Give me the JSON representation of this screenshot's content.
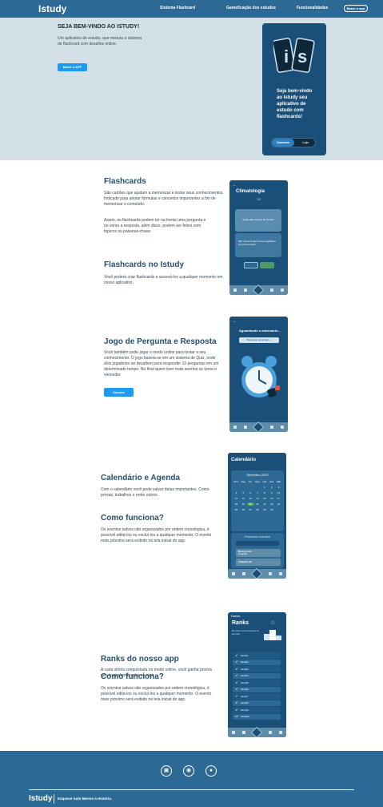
{
  "header": {
    "brand": "Istudy",
    "nav": [
      "Sistema Flashcard",
      "Gameficação dos estudos",
      "Funcionalidades"
    ],
    "cta": "Baixe o app"
  },
  "hero": {
    "title": "SEJA BEM-VINDO AO ISTUDY!",
    "text": "Um aplicativo de estudo, que mistura o sistema de flashcard com desafios online.",
    "button": "Baixe o APP",
    "phone_logo": "iS",
    "phone_text": "Seja bem-vindo ao Istudy seu aplicativo de estudo com flashcards!",
    "phone_seg_a": "Cadastrar",
    "phone_seg_b": "Login"
  },
  "sections": {
    "flashcards": {
      "title": "Flashcards",
      "text1": "São cartões que ajudam a memorizar e testar seus conhecimentos. Indicado para anotar fórmulas e conceitos importantes a fim de memorizar o conteúdo.",
      "text2": "Assim, os flashcards podem ter na frente uma pergunta e no verso a resposta, além disso, podem ser feitos com tópicos ou palavras-chave.",
      "title2": "Flashcards no Istudy",
      "text3": "Você poderá criar flashcards e acessá-los a qualquer momento em nosso aplicativo.",
      "phone_title": "Climatologia",
      "phone_count": "1/2",
      "phone_question": "Quais são os tipos de chuva?",
      "phone_answer": "São: chuva frontal, chuva orográfica e chuva convectiva."
    },
    "quiz": {
      "title": "Jogo de Pergunta e Resposta",
      "text": "Você também pode jogar o modo online para testar o seu conhecimento. O jogo baseia-se em um sistema de Quiz, onde dois jogadores se desafiem para responder 10 perguntas em um determinado tempo. No final quem tiver mais acertos se torna o vencedor.",
      "button": "Usuário",
      "phone_title": "Aguardando o adversário...",
      "phone_bar": "Buscando adversário..."
    },
    "calendar": {
      "title": "Calendário e Agenda",
      "text": "Com o calendário você pode salvar datas importantes. Como provas, trabalhos e entre outros.",
      "title2": "Como funciona?",
      "text2": "Os eventos salvos são organizados por ordem cronológica, é possível editá-los ou excluí-los a qualquer momento. O evento mais próximo será exibido na tela inicial do app.",
      "phone_title": "Calendário",
      "month": "Setembro 2022",
      "weekdays": [
        "Dom",
        "Seg",
        "Ter",
        "Qua",
        "Qui",
        "Sex",
        "Sáb"
      ],
      "days": [
        "",
        "",
        "",
        "",
        "1",
        "2",
        "3",
        "4",
        "5",
        "6",
        "7",
        "8",
        "9",
        "10",
        "11",
        "12",
        "13",
        "14",
        "15",
        "16",
        "17",
        "18",
        "19",
        "20",
        "21",
        "22",
        "23",
        "24",
        "25",
        "26",
        "27",
        "28",
        "29",
        "30",
        ""
      ],
      "events_label": "Próximos eventos",
      "event1": "Nova prova",
      "event1_sub": "Geografia",
      "event2": "Trabalho de"
    },
    "ranks": {
      "title": "Ranks do nosso app",
      "text": "A cada vitória conquistada no modo online, você ganha pontos que te ajudam a subir no rank..",
      "title2": "Como funciona?",
      "text2": "Os eventos salvos são organizados por ordem cronológica, é possível editá-los ou excluí-los a qualquer momento. O evento mais próximo será exibido na tela inicial do app.",
      "phone_top": "Ranks",
      "phone_title": "Ranks",
      "phone_sub": "Em breve você terá acesso ao seu rank",
      "rows": [
        {
          "n": "1º",
          "name": "Istudy1"
        },
        {
          "n": "2º",
          "name": "Istudy2"
        },
        {
          "n": "3º",
          "name": "Istudy3"
        },
        {
          "n": "4º",
          "name": "Istudy4"
        },
        {
          "n": "5º",
          "name": "Istudy5"
        },
        {
          "n": "6º",
          "name": "Istudy6"
        },
        {
          "n": "7º",
          "name": "Istudy7"
        },
        {
          "n": "8º",
          "name": "Istudy8"
        },
        {
          "n": "9º",
          "name": "Istudy9"
        },
        {
          "n": "10º",
          "name": "Istudy10"
        }
      ]
    }
  },
  "footer": {
    "brand": "Istudy",
    "tagline": "Esquece tudo Menos a História.",
    "icons": [
      "instagram-icon",
      "email-icon",
      "discord-icon"
    ]
  },
  "colors": {
    "primary": "#2c6a95",
    "accent": "#1d9bf0",
    "hero_bg": "#d3e0e8",
    "phone": "#1a4f7a"
  }
}
